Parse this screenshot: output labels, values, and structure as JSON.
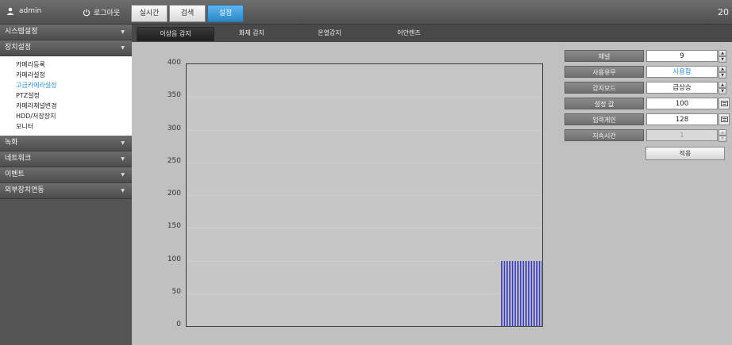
{
  "header": {
    "username": "admin",
    "logout_label": "로그아웃",
    "tabs": [
      {
        "label": "실시간",
        "active": false
      },
      {
        "label": "검색",
        "active": false
      },
      {
        "label": "설정",
        "active": true
      }
    ],
    "clock": "20"
  },
  "sidebar": {
    "sections": [
      {
        "label": "시스템설정"
      },
      {
        "label": "장치설정"
      },
      {
        "label": "녹화"
      },
      {
        "label": "네트워크"
      },
      {
        "label": "이벤트"
      },
      {
        "label": "외부장치연동"
      }
    ],
    "device_items": [
      {
        "label": "카메라등록",
        "active": false
      },
      {
        "label": "카메라설정",
        "active": false
      },
      {
        "label": "고급카메라설정",
        "active": true
      },
      {
        "label": "PTZ설정",
        "active": false
      },
      {
        "label": "카메라채널변경",
        "active": false
      },
      {
        "label": "HDD/저장장치",
        "active": false
      },
      {
        "label": "모니터",
        "active": false
      }
    ]
  },
  "subnav": {
    "tabs": [
      {
        "label": "이상음 감지",
        "active": true
      },
      {
        "label": "화재 감지",
        "active": false
      },
      {
        "label": "온열감지",
        "active": false
      },
      {
        "label": "어안렌즈",
        "active": false
      }
    ]
  },
  "chart_data": {
    "type": "bar",
    "ylim": [
      0,
      400
    ],
    "yticks": [
      "400",
      "350",
      "300",
      "250",
      "200",
      "150",
      "100",
      "50",
      "0"
    ],
    "bars": [
      {
        "x_start": 0.885,
        "x_end": 1.0,
        "value": 100
      }
    ],
    "bar_color": "#3a3ab0",
    "grid": true
  },
  "form": {
    "channel": {
      "label": "채널",
      "value": "9"
    },
    "usage": {
      "label": "사용유무",
      "value": "사용함"
    },
    "detect_mode": {
      "label": "감지모드",
      "value": "급상승"
    },
    "setting_value": {
      "label": "설정 값",
      "value": "100"
    },
    "input_gain": {
      "label": "입력게인",
      "value": "128"
    },
    "duration": {
      "label": "지속시간",
      "value": "1"
    },
    "apply_label": "적용"
  }
}
